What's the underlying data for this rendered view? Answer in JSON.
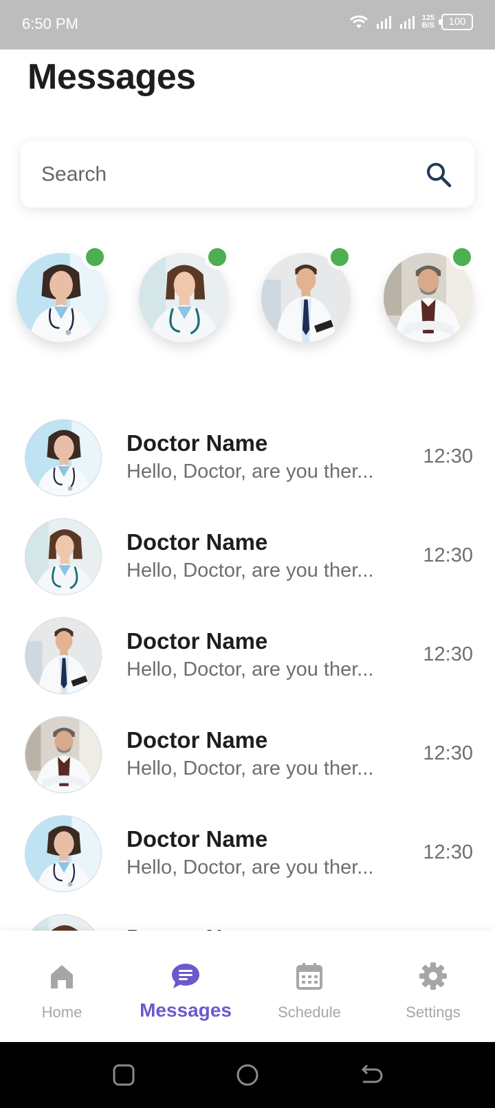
{
  "status_bar": {
    "time": "6:50 PM",
    "speed_top": "125",
    "speed_bottom": "B/S",
    "battery": "100"
  },
  "header": {
    "title": "Messages"
  },
  "search": {
    "placeholder": "Search",
    "icon": "search-icon"
  },
  "online_doctors": [
    {
      "id": "doctor-1",
      "online": true
    },
    {
      "id": "doctor-2",
      "online": true
    },
    {
      "id": "doctor-3",
      "online": true
    },
    {
      "id": "doctor-4",
      "online": true
    }
  ],
  "messages": [
    {
      "name": "Doctor Name",
      "preview": "Hello, Doctor, are you ther...",
      "time": "12:30"
    },
    {
      "name": "Doctor Name",
      "preview": "Hello, Doctor, are you ther...",
      "time": "12:30"
    },
    {
      "name": "Doctor Name",
      "preview": "Hello, Doctor, are you ther...",
      "time": "12:30"
    },
    {
      "name": "Doctor Name",
      "preview": "Hello, Doctor, are you ther...",
      "time": "12:30"
    },
    {
      "name": "Doctor Name",
      "preview": "Hello, Doctor, are you ther...",
      "time": "12:30"
    },
    {
      "name": "Doctor Name",
      "preview": "",
      "time": ""
    }
  ],
  "bottom_nav": {
    "home": "Home",
    "messages": "Messages",
    "schedule": "Schedule",
    "settings": "Settings",
    "active": "messages",
    "active_color": "#6a5acd",
    "inactive_color": "#a6a6a6"
  },
  "colors": {
    "online_dot": "#4caf50",
    "status_bar": "#bdbdbd",
    "search_icon": "#1f3a5a"
  }
}
